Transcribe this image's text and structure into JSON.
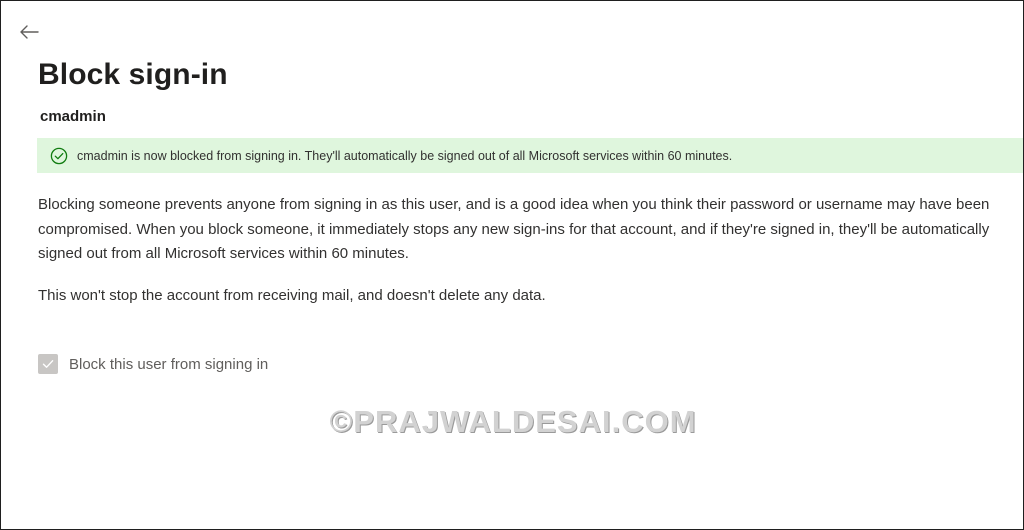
{
  "header": {
    "back_icon": "arrow-left-icon",
    "title": "Block sign-in",
    "username": "cmadmin"
  },
  "banner": {
    "icon": "check-circle-icon",
    "message": "cmadmin is now blocked from signing in. They'll automatically be signed out of all Microsoft services within 60 minutes.",
    "color": "#dff6dd",
    "icon_color": "#107c10"
  },
  "body": {
    "description": "Blocking someone prevents anyone from signing in as this user, and is a good idea when you think their password or username may have been compromised. When you block someone, it immediately stops any new sign-ins for that account, and if they're signed in, they'll be automatically signed out from all Microsoft services within 60 minutes.",
    "note": "This won't stop the account from receiving mail, and doesn't delete any data."
  },
  "checkbox": {
    "label": "Block this user from signing in",
    "checked": true,
    "disabled": true
  },
  "watermark": "©PRAJWALDESAI.COM"
}
